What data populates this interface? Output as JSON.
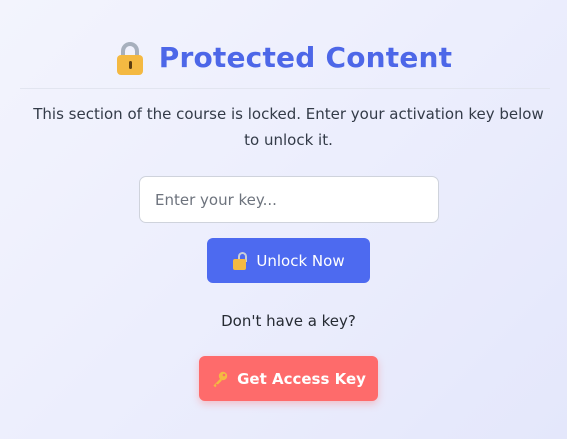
{
  "header": {
    "title": "Protected Content"
  },
  "main": {
    "description": "This section of the course is locked. Enter your activation key below to unlock it.",
    "key_input": {
      "placeholder": "Enter your key...",
      "value": ""
    },
    "unlock_button_label": "Unlock Now",
    "no_key_text": "Don't have a key?",
    "access_button_label": "Get Access Key"
  },
  "icons": {
    "title_icon": "lock-icon",
    "unlock_icon": "open-lock-icon",
    "access_icon": "key-icon"
  },
  "colors": {
    "title": "#4d67e8",
    "unlock_button": "#4d6af0",
    "access_button": "#fe6b6b",
    "lock_gold": "#f4b942"
  }
}
